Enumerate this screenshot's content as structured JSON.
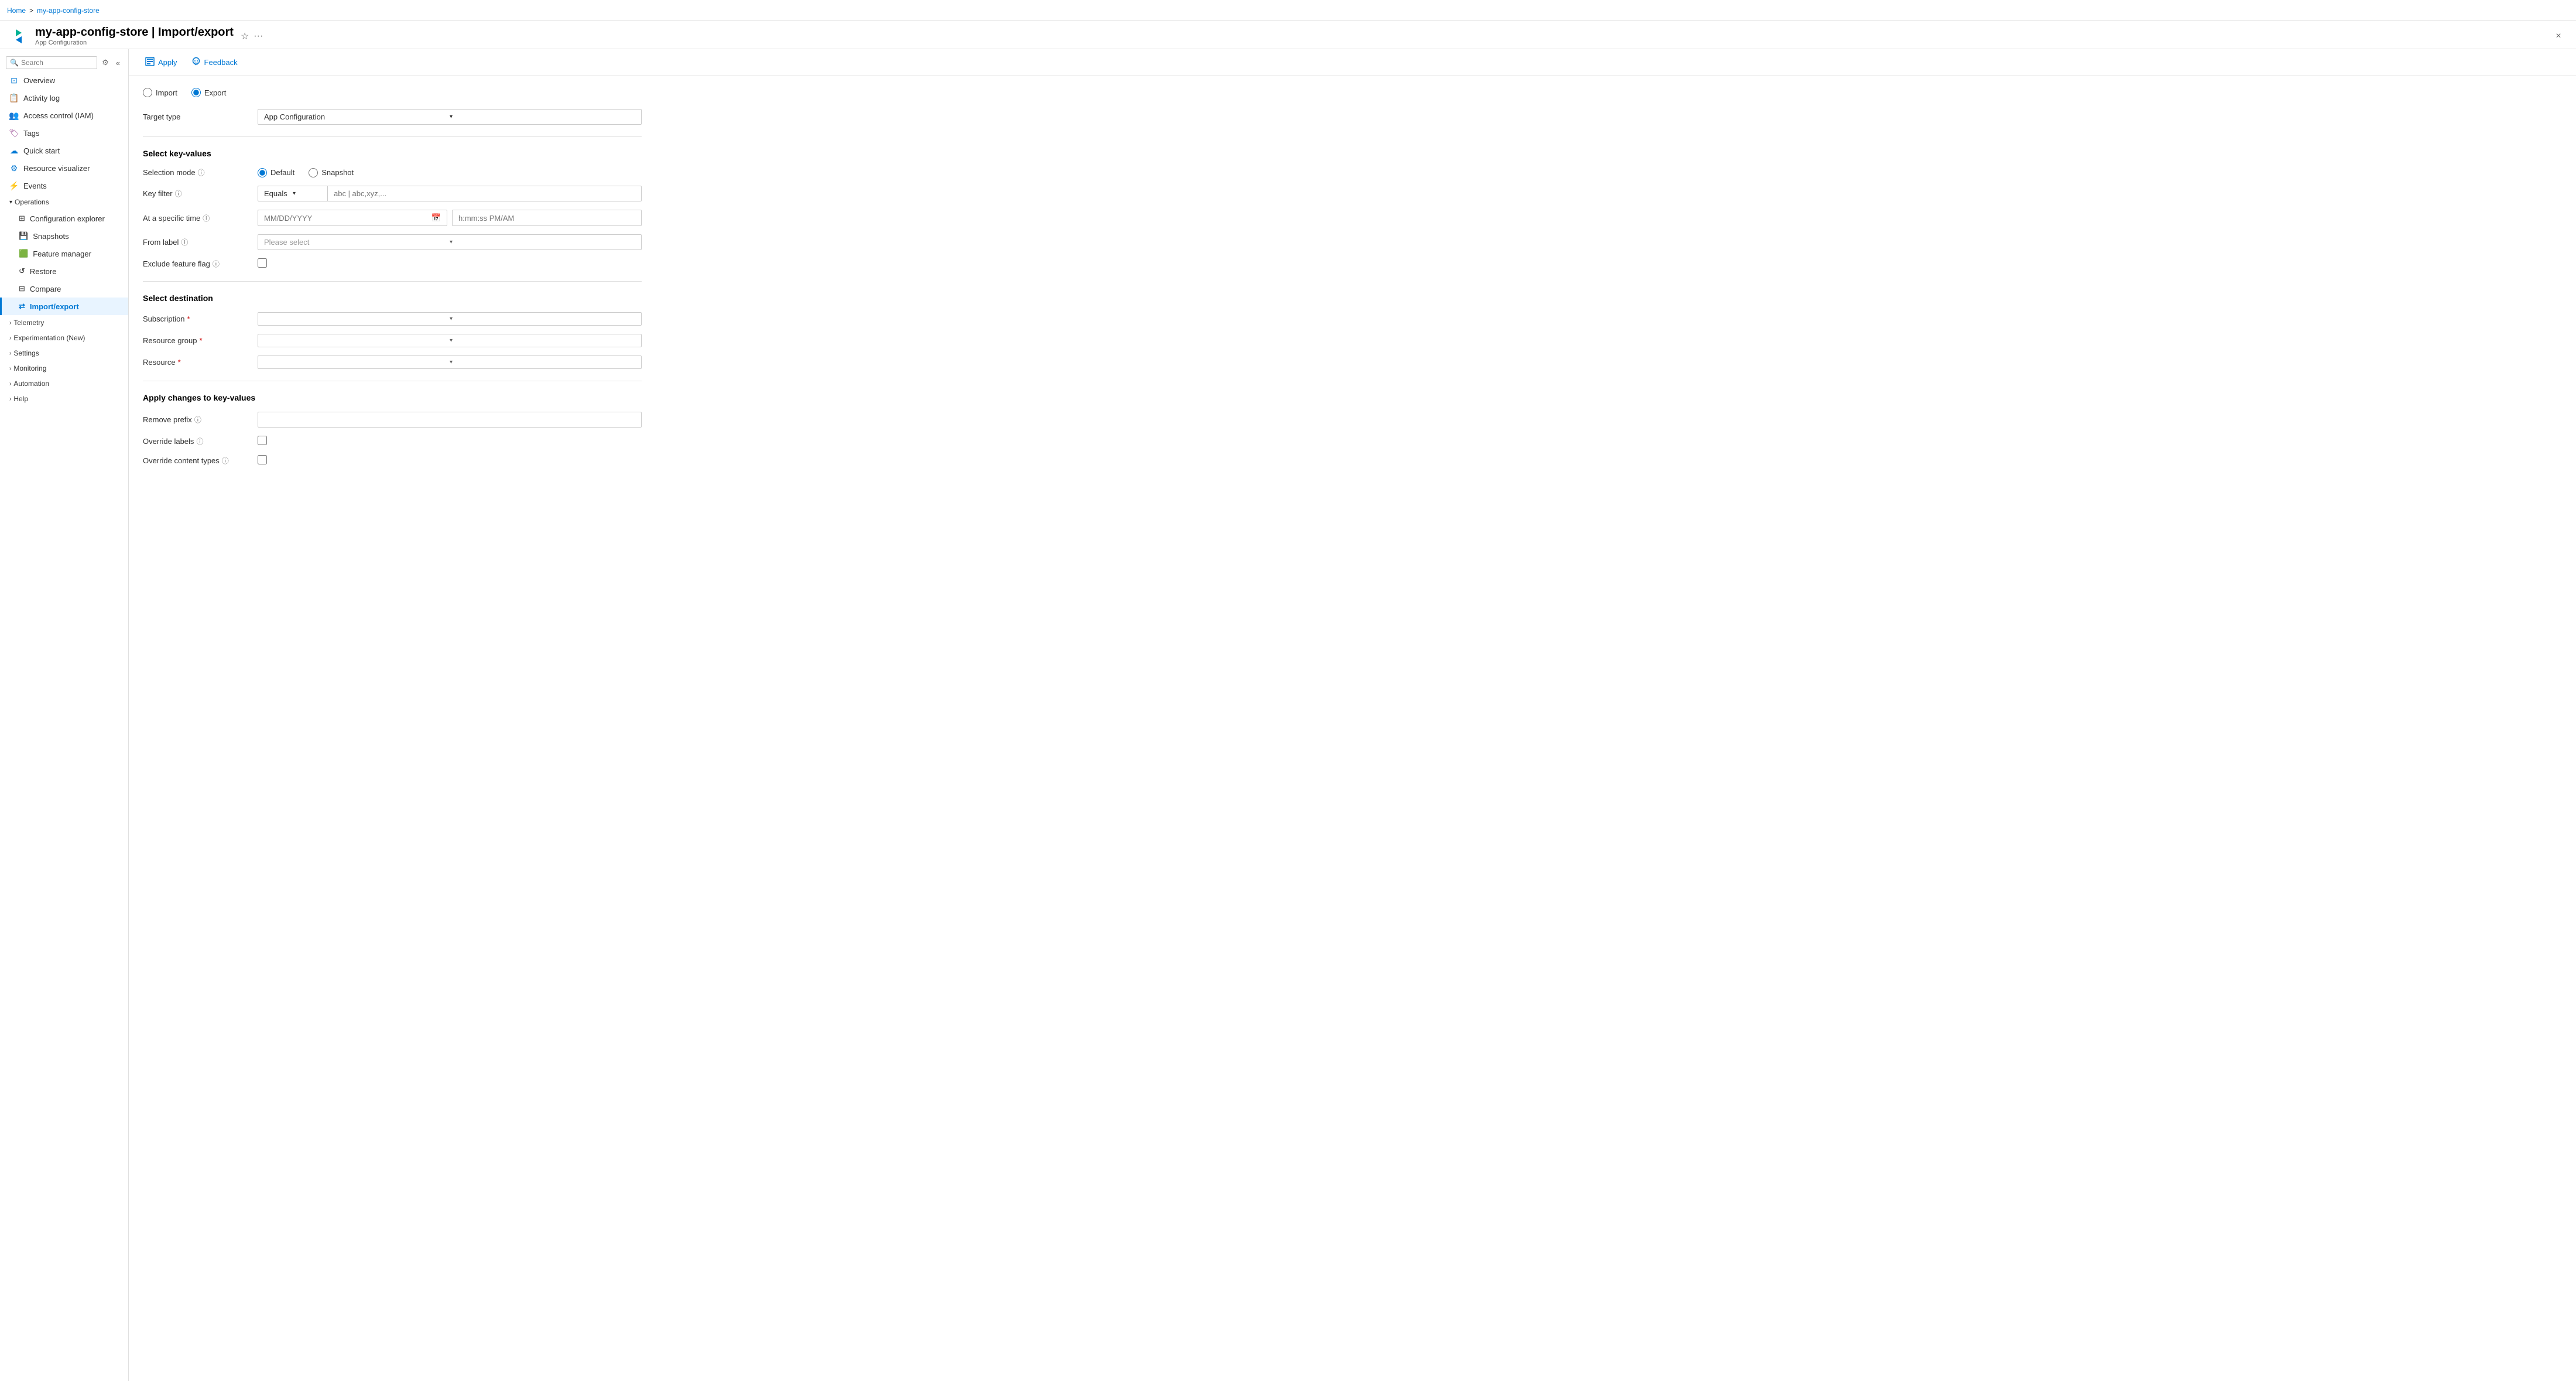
{
  "breadcrumb": {
    "home": "Home",
    "separator": ">",
    "current": "my-app-config-store"
  },
  "header": {
    "title": "my-app-config-store | Import/export",
    "subtitle": "App Configuration",
    "icon_right": "★",
    "icon_ellipsis": "···",
    "close_label": "×"
  },
  "sidebar": {
    "search_placeholder": "Search",
    "nav_items": [
      {
        "id": "overview",
        "label": "Overview",
        "icon": "⊡"
      },
      {
        "id": "activity-log",
        "label": "Activity log",
        "icon": "📋"
      },
      {
        "id": "access-control",
        "label": "Access control (IAM)",
        "icon": "👥"
      },
      {
        "id": "tags",
        "label": "Tags",
        "icon": "🏷"
      },
      {
        "id": "quick-start",
        "label": "Quick start",
        "icon": "☁"
      },
      {
        "id": "resource-visualizer",
        "label": "Resource visualizer",
        "icon": "⚙"
      },
      {
        "id": "events",
        "label": "Events",
        "icon": "⚡"
      }
    ],
    "sections": [
      {
        "id": "operations",
        "label": "Operations",
        "expanded": true,
        "sub_items": [
          {
            "id": "configuration-explorer",
            "label": "Configuration explorer",
            "icon": "⊞"
          },
          {
            "id": "snapshots",
            "label": "Snapshots",
            "icon": "💾"
          },
          {
            "id": "feature-manager",
            "label": "Feature manager",
            "icon": "🟩"
          },
          {
            "id": "restore",
            "label": "Restore",
            "icon": "↺"
          },
          {
            "id": "compare",
            "label": "Compare",
            "icon": "⊟"
          },
          {
            "id": "import-export",
            "label": "Import/export",
            "icon": "⇄",
            "active": true
          }
        ]
      },
      {
        "id": "telemetry",
        "label": "Telemetry",
        "expanded": false,
        "sub_items": []
      },
      {
        "id": "experimentation",
        "label": "Experimentation (New)",
        "expanded": false,
        "sub_items": []
      },
      {
        "id": "settings",
        "label": "Settings",
        "expanded": false,
        "sub_items": []
      },
      {
        "id": "monitoring",
        "label": "Monitoring",
        "expanded": false,
        "sub_items": []
      },
      {
        "id": "automation",
        "label": "Automation",
        "expanded": false,
        "sub_items": []
      },
      {
        "id": "help",
        "label": "Help",
        "expanded": false,
        "sub_items": []
      }
    ]
  },
  "toolbar": {
    "apply_label": "Apply",
    "feedback_label": "Feedback"
  },
  "form": {
    "import_label": "Import",
    "export_label": "Export",
    "export_selected": true,
    "target_type": {
      "label": "Target type",
      "value": "App Configuration"
    },
    "select_key_values_title": "Select key-values",
    "selection_mode": {
      "label": "Selection mode",
      "options": [
        "Default",
        "Snapshot"
      ],
      "selected": "Default"
    },
    "key_filter": {
      "label": "Key filter",
      "operator": "Equals",
      "placeholder": "abc | abc,xyz,..."
    },
    "at_specific_time": {
      "label": "At a specific time",
      "date_placeholder": "MM/DD/YYYY",
      "time_placeholder": "h:mm:ss PM/AM"
    },
    "from_label": {
      "label": "From label",
      "placeholder": "Please select"
    },
    "exclude_feature_flag": {
      "label": "Exclude feature flag"
    },
    "select_destination_title": "Select destination",
    "subscription": {
      "label": "Subscription",
      "required": true,
      "placeholder": ""
    },
    "resource_group": {
      "label": "Resource group",
      "required": true,
      "placeholder": ""
    },
    "resource": {
      "label": "Resource",
      "required": true,
      "placeholder": ""
    },
    "apply_changes_title": "Apply changes to key-values",
    "remove_prefix": {
      "label": "Remove prefix",
      "value": ""
    },
    "override_labels": {
      "label": "Override labels"
    },
    "override_content_types": {
      "label": "Override content types"
    }
  }
}
